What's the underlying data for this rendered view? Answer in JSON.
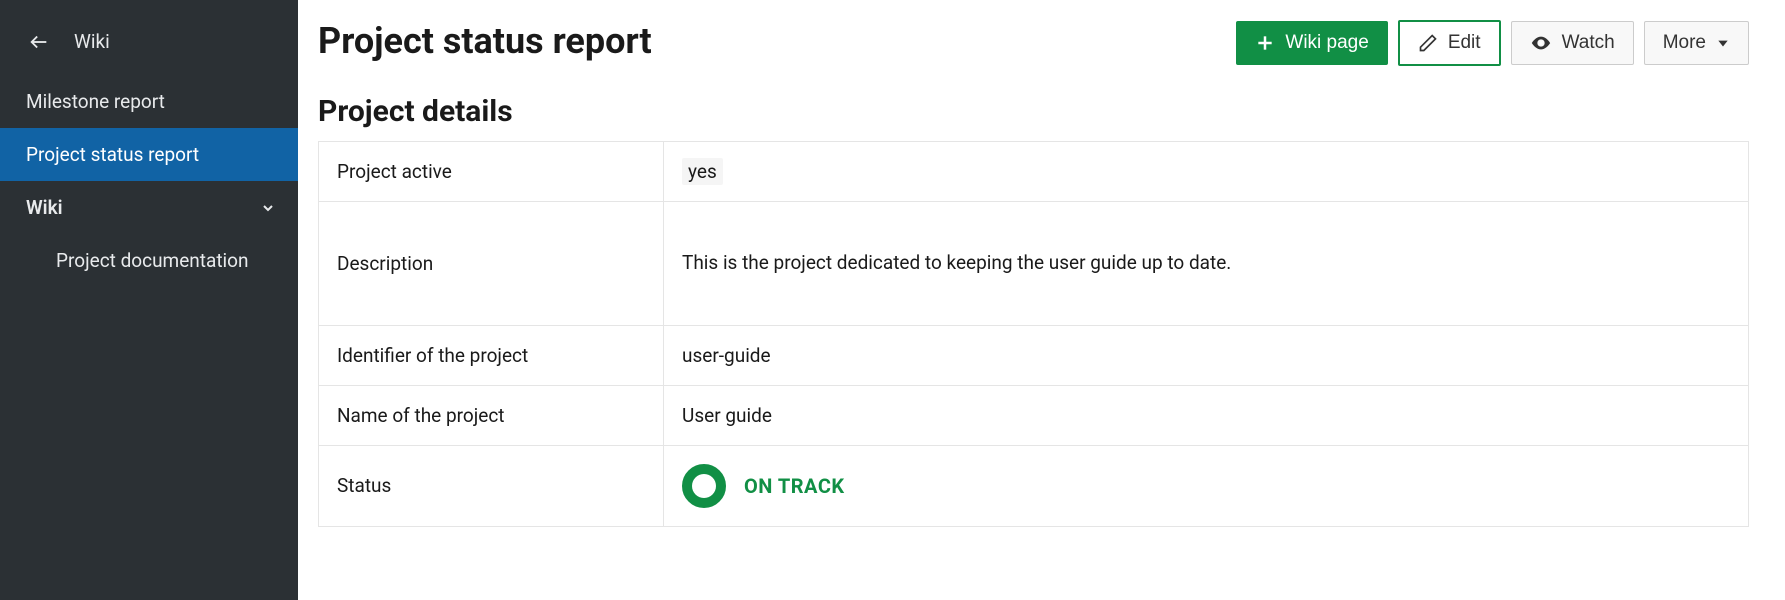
{
  "sidebar": {
    "title": "Wiki",
    "items": [
      {
        "label": "Milestone report"
      },
      {
        "label": "Project status report"
      },
      {
        "label": "Wiki"
      }
    ],
    "subitems": [
      {
        "label": "Project documentation"
      }
    ]
  },
  "page": {
    "title": "Project status report",
    "section_title": "Project details"
  },
  "actions": {
    "wiki_page": "Wiki page",
    "edit": "Edit",
    "watch": "Watch",
    "more": "More"
  },
  "details": {
    "rows": [
      {
        "label": "Project active",
        "value": "yes",
        "code": true
      },
      {
        "label": "Description",
        "value": "This is the project dedicated to keeping the user guide up to date.",
        "desc": true
      },
      {
        "label": "Identifier of the project",
        "value": "user-guide"
      },
      {
        "label": "Name of the project",
        "value": "User guide"
      },
      {
        "label": "Status",
        "status": "ON TRACK",
        "status_color": "#118f45"
      }
    ]
  }
}
